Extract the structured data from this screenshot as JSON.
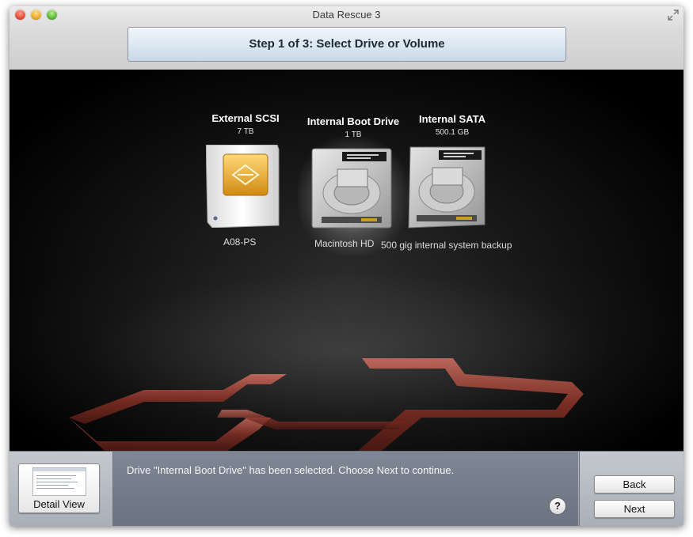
{
  "window": {
    "title": "Data Rescue 3"
  },
  "header": {
    "step_title": "Step 1 of 3: Select Drive or Volume"
  },
  "drives": [
    {
      "name": "External SCSI",
      "size": "7 TB",
      "volume": "A08-PS",
      "icon": "external-drive-icon",
      "selected": false
    },
    {
      "name": "Internal Boot Drive",
      "size": "1 TB",
      "volume": "Macintosh HD",
      "icon": "internal-hard-drive-icon",
      "selected": true
    },
    {
      "name": "Internal SATA",
      "size": "500.1 GB",
      "volume": "500 gig internal system backup",
      "icon": "internal-hard-drive-icon",
      "selected": false
    }
  ],
  "bottom": {
    "detail_view_label": "Detail View",
    "status_message": "Drive \"Internal Boot Drive\" has been selected. Choose Next to continue.",
    "help_label": "?",
    "back_label": "Back",
    "next_label": "Next"
  },
  "colors": {
    "logo": "#8a3a2e",
    "stage_bg": "#000000",
    "message_bg": "#737b89"
  }
}
